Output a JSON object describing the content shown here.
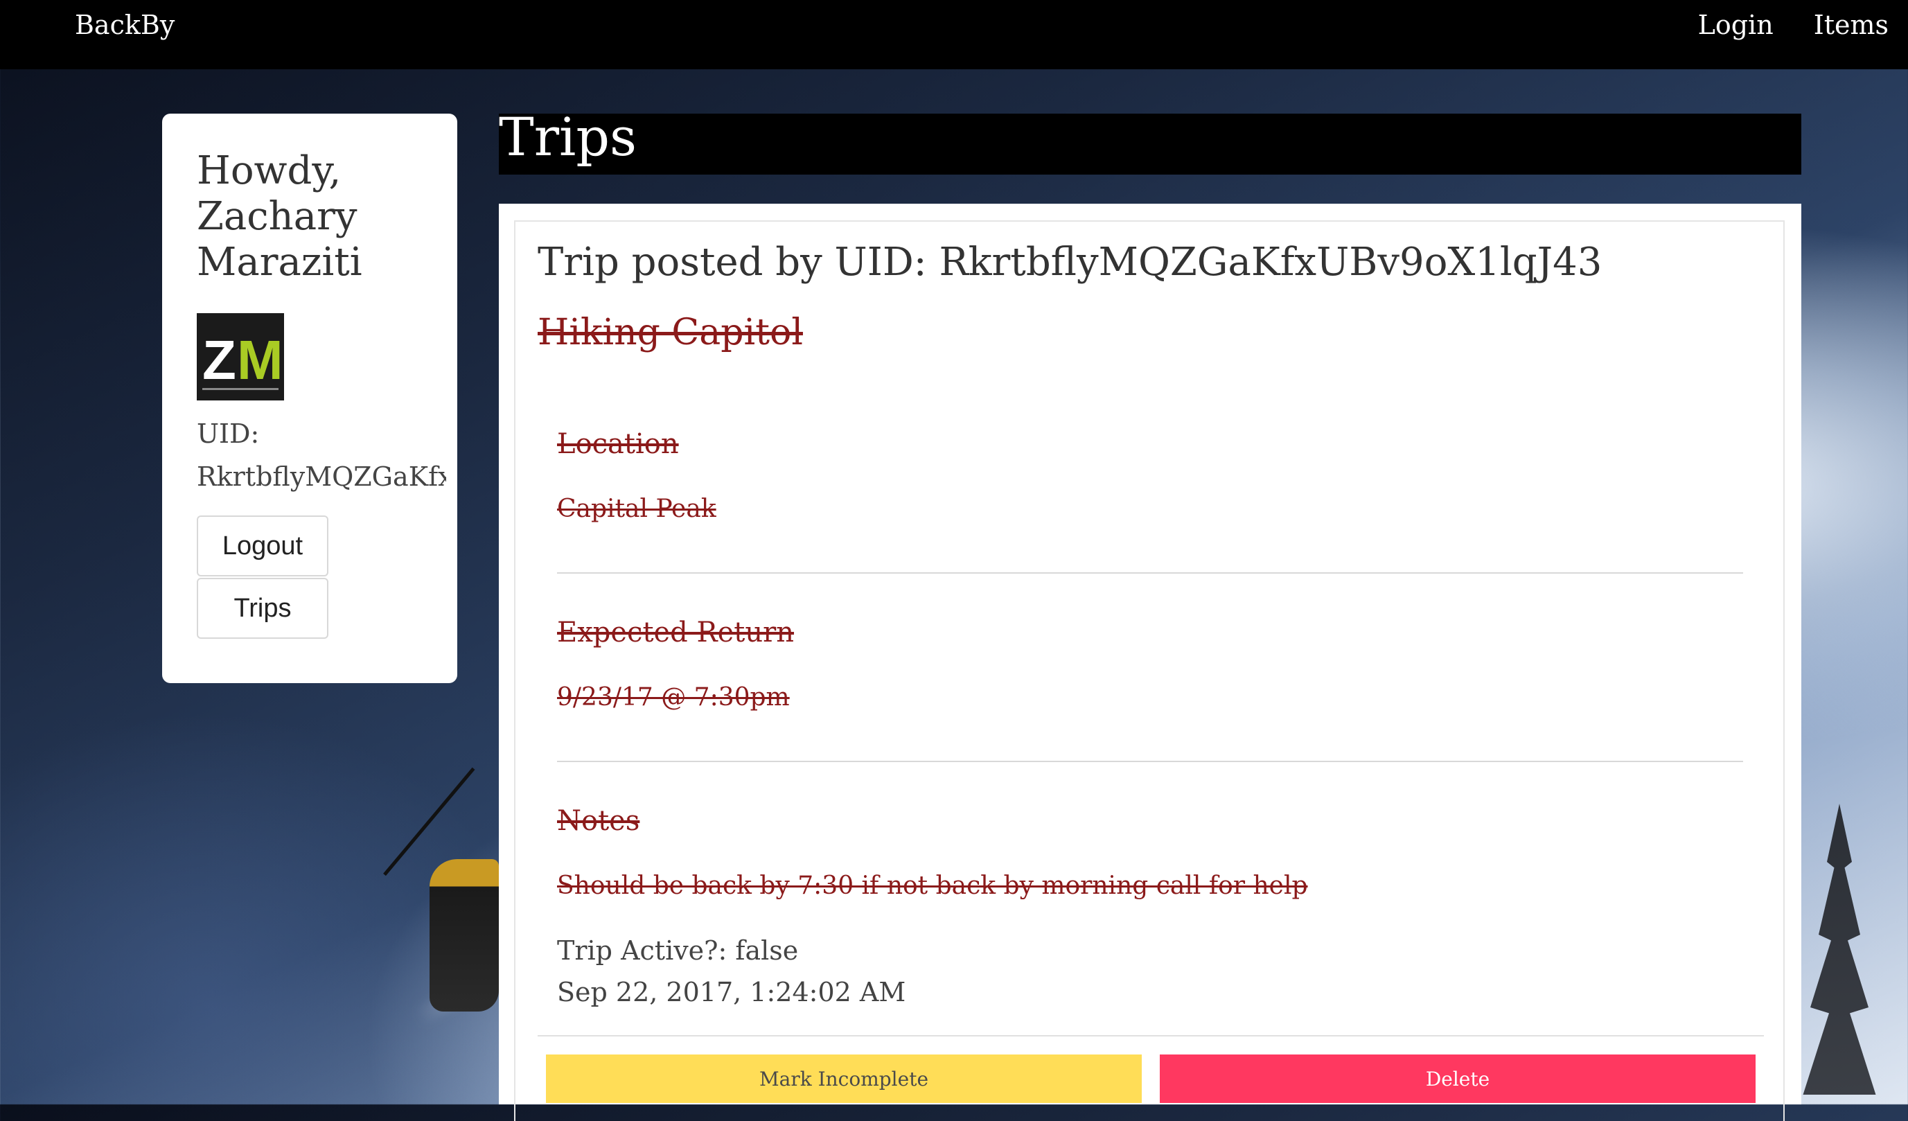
{
  "navbar": {
    "brand": "BackBy",
    "links": [
      "Login",
      "Items"
    ]
  },
  "sidebar": {
    "greeting": "Howdy, Zachary Maraziti",
    "avatar": {
      "letters_left": "Z",
      "letters_right": "M",
      "accent_color": "#a9cc24"
    },
    "uid_label": "UID:",
    "uid_value": "RkrtbflyMQZGaKfxU",
    "logout_label": "Logout",
    "trips_label": "Trips"
  },
  "main": {
    "title": "Trips",
    "trip": {
      "posted_by": "Trip posted by UID: RkrtbflyMQZGaKfxUBv9oX1lqJ43",
      "name": "Hiking Capitol",
      "location_label": "Location",
      "location_value": "Capital Peak",
      "return_label": "Expected Return",
      "return_value": "9/23/17 @ 7:30pm",
      "notes_label": "Notes",
      "notes_value": "Should be back by 7:30 if not back by morning call for help",
      "active_text": "Trip Active?: false",
      "timestamp": "Sep 22, 2017, 1:24:02 AM",
      "mark_incomplete_label": "Mark Incomplete",
      "delete_label": "Delete"
    }
  },
  "colors": {
    "completed_text": "#8b1a1a",
    "mark_incomplete_bg": "#ffdd57",
    "delete_bg": "#ff3860"
  }
}
